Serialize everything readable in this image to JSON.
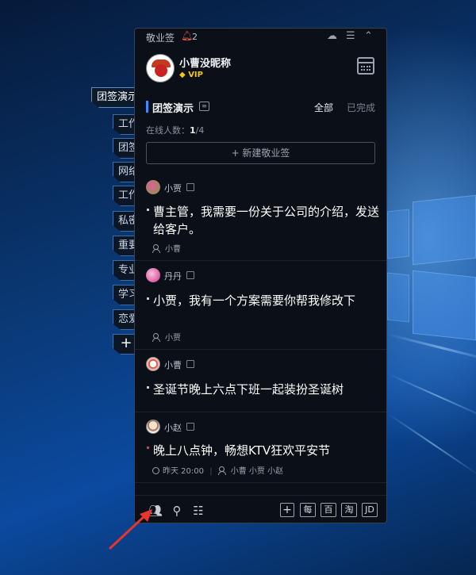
{
  "side_tabs": [
    {
      "label": "团签演示",
      "active": true
    },
    {
      "label": "工作"
    },
    {
      "label": "团签"
    },
    {
      "label": "网络"
    },
    {
      "label": "工作"
    },
    {
      "label": "私密"
    },
    {
      "label": "重要"
    },
    {
      "label": "专业"
    },
    {
      "label": "学习"
    },
    {
      "label": "恋爱"
    },
    {
      "label": "+"
    }
  ],
  "titlebar": {
    "app_title": "敬业签",
    "bell_icon": "bell-icon",
    "notification_count": "2"
  },
  "profile": {
    "username": "小曹没昵称",
    "vip_label": "VIP"
  },
  "group": {
    "name": "团签演示",
    "filter_all": "全部",
    "filter_done": "已完成",
    "online_label": "在线人数：",
    "online_count": "1",
    "online_total": "/4"
  },
  "new_button": "+ 新建敬业签",
  "items": [
    {
      "author": "小贾",
      "text": "曹主管，我需要一份关于公司的介绍，发送给客户。",
      "assignee": "小曹"
    },
    {
      "author": "丹丹",
      "text": "小贾，我有一个方案需要你帮我修改下",
      "assignee": "小贾"
    },
    {
      "author": "小曹",
      "text": "圣诞节晚上六点下班一起装扮圣诞树"
    },
    {
      "author": "小赵",
      "text": "晚上八点钟，畅想KTV狂欢平安节",
      "time": "昨天 20:00",
      "assignee": "小曹 小贾 小赵"
    }
  ],
  "bottom_buttons": [
    "每",
    "百",
    "淘",
    "JD"
  ],
  "colors": {
    "accent": "#3a8cff",
    "vip": "#f5c518",
    "urgent": "#e33b2e",
    "panel_bg": "#0b0f17"
  }
}
